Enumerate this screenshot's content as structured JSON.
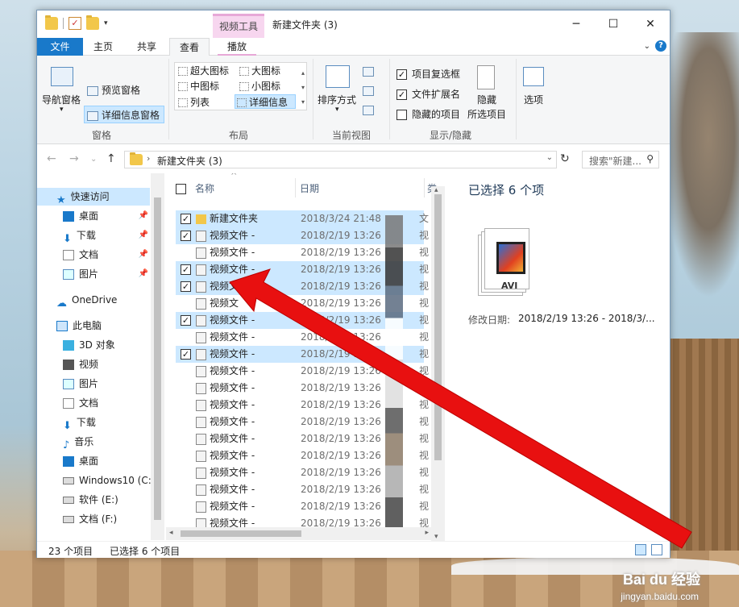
{
  "titlebar": {
    "context_tab": "视频工具",
    "title": "新建文件夹 (3)",
    "minimize": "─",
    "maximize": "☐",
    "close": "✕"
  },
  "tabs": {
    "file": "文件",
    "home": "主页",
    "share": "共享",
    "view": "查看",
    "play": "播放"
  },
  "ribbon": {
    "pane_group": {
      "nav_pane": "导航窗格",
      "preview_pane": "预览窗格",
      "details_pane": "详细信息窗格",
      "label": "窗格"
    },
    "layout_group": {
      "items": [
        "超大图标",
        "大图标",
        "中图标",
        "小图标",
        "列表",
        "详细信息"
      ],
      "label": "布局"
    },
    "view_group": {
      "sort": "排序方式",
      "label": "当前视图"
    },
    "show_group": {
      "item_checkbox": "项目复选框",
      "file_ext": "文件扩展名",
      "hidden_items": "隐藏的项目",
      "hide_selected_1": "隐藏",
      "hide_selected_2": "所选项目",
      "label": "显示/隐藏"
    },
    "options": "选项"
  },
  "address": {
    "path": "新建文件夹 (3)",
    "search_placeholder": "搜索\"新建...",
    "chevron": "›"
  },
  "nav": {
    "items": [
      {
        "label": "快速访问"
      },
      {
        "label": "桌面"
      },
      {
        "label": "下载"
      },
      {
        "label": "文档"
      },
      {
        "label": "图片"
      },
      {
        "label": "OneDrive"
      },
      {
        "label": "此电脑"
      },
      {
        "label": "3D 对象"
      },
      {
        "label": "视频"
      },
      {
        "label": "图片"
      },
      {
        "label": "文档"
      },
      {
        "label": "下载"
      },
      {
        "label": "音乐"
      },
      {
        "label": "桌面"
      },
      {
        "label": "Windows10 (C:"
      },
      {
        "label": "软件 (E:)"
      },
      {
        "label": "文档 (F:)"
      }
    ]
  },
  "list": {
    "col_name": "名称",
    "col_date": "日期",
    "col_type": "类",
    "rows": [
      {
        "name": "新建文件夹",
        "date": "2018/3/24 21:48",
        "type": "文",
        "selected": true,
        "folder": true
      },
      {
        "name": "视频文件 -",
        "date": "2018/2/19 13:26",
        "type": "视",
        "selected": true
      },
      {
        "name": "视频文件 -",
        "date": "2018/2/19 13:26",
        "type": "视",
        "selected": false
      },
      {
        "name": "视频文件 -",
        "date": "2018/2/19 13:26",
        "type": "视",
        "selected": true
      },
      {
        "name": "视频文件 -",
        "date": "2018/2/19 13:26",
        "type": "视",
        "selected": true
      },
      {
        "name": "视频文",
        "date": "2018/2/19 13:26",
        "type": "视",
        "selected": false
      },
      {
        "name": "视频文件 -",
        "date": "2018/2/19 13:26",
        "type": "视",
        "selected": true
      },
      {
        "name": "视频文件 -",
        "date": "2018/2/19 13:26",
        "type": "视",
        "selected": false
      },
      {
        "name": "视频文件 -",
        "date": "2018/2/19 13:26",
        "type": "视",
        "selected": true
      },
      {
        "name": "视频文件 -",
        "date": "2018/2/19 13:26",
        "type": "视",
        "selected": false
      },
      {
        "name": "视频文件 -",
        "date": "2018/2/19 13:26",
        "type": "视",
        "selected": false
      },
      {
        "name": "视频文件 -",
        "date": "2018/2/19 13:26",
        "type": "视",
        "selected": false
      },
      {
        "name": "视频文件 -",
        "date": "2018/2/19 13:26",
        "type": "视",
        "selected": false
      },
      {
        "name": "视频文件 -",
        "date": "2018/2/19 13:26",
        "type": "视",
        "selected": false
      },
      {
        "name": "视频文件 -",
        "date": "2018/2/19 13:26",
        "type": "视",
        "selected": false
      },
      {
        "name": "视频文件 -",
        "date": "2018/2/19 13:26",
        "type": "视",
        "selected": false
      },
      {
        "name": "视频文件 -",
        "date": "2018/2/19 13:26",
        "type": "视",
        "selected": false
      },
      {
        "name": "视频文件 -",
        "date": "2018/2/19 13:26",
        "type": "视",
        "selected": false
      },
      {
        "name": "视频文件 -",
        "date": "2018/2/19 13:26",
        "type": "视",
        "selected": false
      }
    ]
  },
  "details": {
    "title": "已选择 6 个项",
    "thumb_label": "AVI",
    "modified_key": "修改日期:",
    "modified_val": "2018/2/19 13:26 - 2018/3/..."
  },
  "status": {
    "count": "23 个项目",
    "selected": "已选择 6 个项目"
  },
  "watermark": {
    "brand": "Bai du 经验",
    "url": "jingyan.baidu.com"
  },
  "colors": {
    "accent": "#1979ca",
    "selection": "#cce8ff",
    "context_tab": "#f7d6ef",
    "arrow": "#e81010"
  }
}
